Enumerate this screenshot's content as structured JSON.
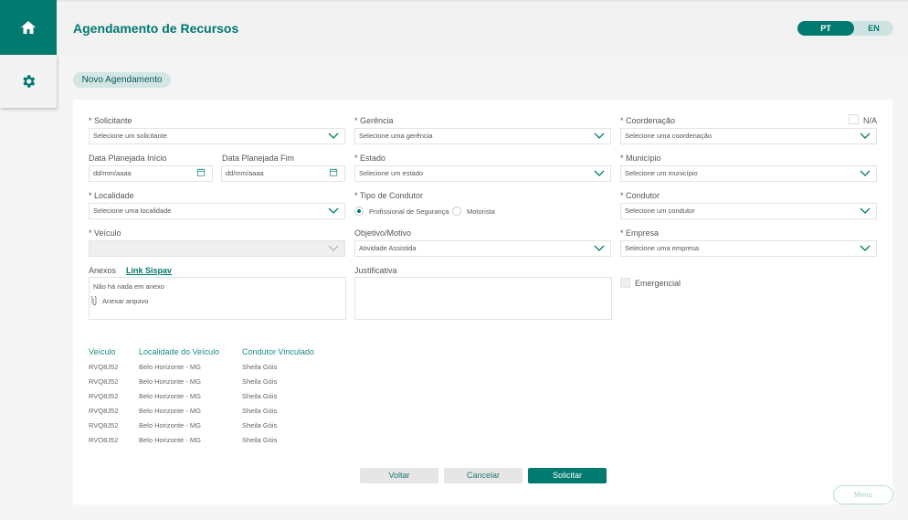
{
  "header": {
    "title": "Agendamento de Recursos",
    "lang": {
      "pt": "PT",
      "en": "EN",
      "active": "PT"
    }
  },
  "sidebar": {
    "items": [
      {
        "icon": "home-icon",
        "active": true
      },
      {
        "icon": "gear-icon",
        "active": false
      }
    ]
  },
  "section_tag": "Novo Agendamento",
  "colors": {
    "accent": "#00796f"
  },
  "form": {
    "solicitante": {
      "label": "* Solicitante",
      "placeholder": "Selecione um solicitante"
    },
    "gerencia": {
      "label": "* Gerência",
      "placeholder": "Selecione uma gerência"
    },
    "coordenacao": {
      "label": "* Coordenação",
      "placeholder": "Selecione uma coordenação",
      "na_label": "N/A"
    },
    "data_inicio": {
      "label": "Data Planejada Início",
      "placeholder": "dd/mm/aaaa"
    },
    "data_fim": {
      "label": "Data Planejada Fim",
      "placeholder": "dd/mm/aaaa"
    },
    "estado": {
      "label": "* Estado",
      "placeholder": "Selecione um estado"
    },
    "municipio": {
      "label": "* Município",
      "placeholder": "Selecione um município"
    },
    "localidade": {
      "label": "* Localidade",
      "placeholder": "Selecione uma localidade"
    },
    "tipo_condutor": {
      "label": "* Tipo de Condutor",
      "options": [
        "Profissional de Segurança",
        "Motorista"
      ],
      "selected": "Profissional de Segurança"
    },
    "condutor": {
      "label": "* Condutor",
      "placeholder": "Selecione um condutor"
    },
    "veiculo": {
      "label": "* Veículo",
      "value": ""
    },
    "objetivo": {
      "label": "Objetivo/Motivo",
      "value": "Atividade Assistida"
    },
    "empresa": {
      "label": "* Empresa",
      "placeholder": "Selecione uma empresa"
    },
    "anexos": {
      "label": "Anexos",
      "link": "Link Sispav",
      "empty": "Não há nada em anexo",
      "attach": "Anexar arquivo"
    },
    "justificativa": {
      "label": "Justificativa",
      "value": ""
    },
    "emergencial": {
      "label": "Emergencial",
      "checked": false
    }
  },
  "table": {
    "headers": [
      "Veículo",
      "Localidade do Veículo",
      "Condutor Vinculado"
    ],
    "rows": [
      [
        "RVQ8J52",
        "Belo Horizonte - MG",
        "Sheila Góis"
      ],
      [
        "RVQ8J52",
        "Belo Horizonte - MG",
        "Sheila Góis"
      ],
      [
        "RVQ8J52",
        "Belo Horizonte - MG",
        "Sheila Góis"
      ],
      [
        "RVQ8J52",
        "Belo Horizonte - MG",
        "Sheila Góis"
      ],
      [
        "RVQ8J52",
        "Belo Horizonte - MG",
        "Sheila Góis"
      ],
      [
        "RVQ8J52",
        "Belo Horizonte - MG",
        "Sheila Góis"
      ]
    ]
  },
  "buttons": {
    "voltar": "Voltar",
    "cancelar": "Cancelar",
    "solicitar": "Solicitar",
    "menu": "Menu"
  }
}
